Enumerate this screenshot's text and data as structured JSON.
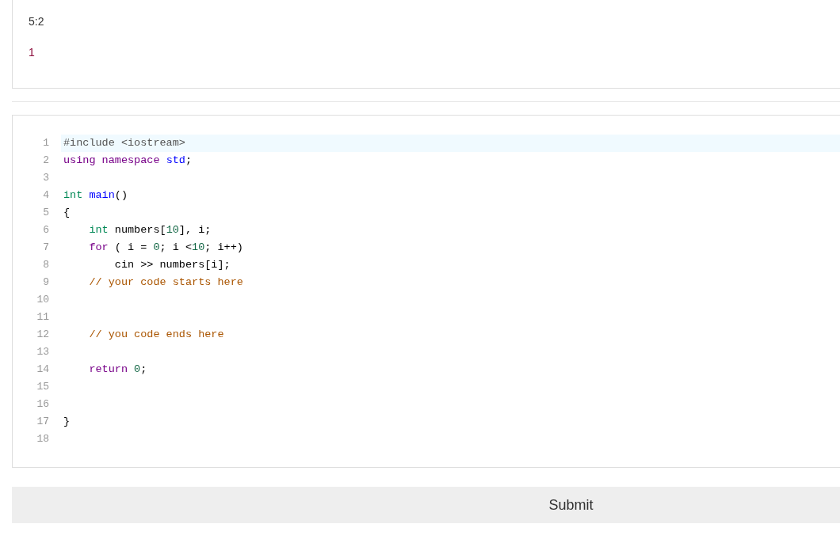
{
  "output": {
    "position": "5:2",
    "result": "1"
  },
  "editor": {
    "lines": [
      {
        "number": "1",
        "active": true,
        "tokens": [
          {
            "text": "#include <iostream>",
            "kind": "meta"
          }
        ]
      },
      {
        "number": "2",
        "active": false,
        "tokens": [
          {
            "text": "using namespace",
            "kind": "keyword"
          },
          {
            "text": " std",
            "kind": "def"
          },
          {
            "text": ";",
            "kind": "plain"
          }
        ]
      },
      {
        "number": "3",
        "active": false
      },
      {
        "number": "4",
        "active": false,
        "tokens": [
          {
            "text": "int",
            "kind": "type"
          },
          {
            "text": " main",
            "kind": "def"
          },
          {
            "text": "()",
            "kind": "plain"
          }
        ]
      },
      {
        "number": "5",
        "active": false,
        "tokens": [
          {
            "text": "{",
            "kind": "plain"
          }
        ]
      },
      {
        "number": "6",
        "active": false,
        "tokens": [
          {
            "text": "    int",
            "kind": "type"
          },
          {
            "text": " numbers[",
            "kind": "plain"
          },
          {
            "text": "10",
            "kind": "number"
          },
          {
            "text": "], i;",
            "kind": "plain"
          }
        ]
      },
      {
        "number": "7",
        "active": false,
        "tokens": [
          {
            "text": "    for",
            "kind": "keyword"
          },
          {
            "text": " ( i = ",
            "kind": "plain"
          },
          {
            "text": "0",
            "kind": "number"
          },
          {
            "text": "; i <",
            "kind": "plain"
          },
          {
            "text": "10",
            "kind": "number"
          },
          {
            "text": "; i++)",
            "kind": "plain"
          }
        ]
      },
      {
        "number": "8",
        "active": false,
        "tokens": [
          {
            "text": "        cin >> numbers[i];",
            "kind": "plain"
          }
        ]
      },
      {
        "number": "9",
        "active": false,
        "tokens": [
          {
            "text": "    // your code starts here",
            "kind": "comment"
          }
        ]
      },
      {
        "number": "10",
        "active": false
      },
      {
        "number": "11",
        "active": false
      },
      {
        "number": "12",
        "active": false,
        "tokens": [
          {
            "text": "    // you code ends here",
            "kind": "comment"
          }
        ]
      },
      {
        "number": "13",
        "active": false
      },
      {
        "number": "14",
        "active": false,
        "tokens": [
          {
            "text": "    return",
            "kind": "keyword"
          },
          {
            "text": " 0",
            "kind": "number"
          },
          {
            "text": ";",
            "kind": "plain"
          }
        ]
      },
      {
        "number": "15",
        "active": false
      },
      {
        "number": "16",
        "active": false
      },
      {
        "number": "17",
        "active": false,
        "tokens": [
          {
            "text": "}",
            "kind": "plain"
          }
        ]
      },
      {
        "number": "18",
        "active": false
      }
    ]
  },
  "submit": {
    "label": "Submit"
  }
}
